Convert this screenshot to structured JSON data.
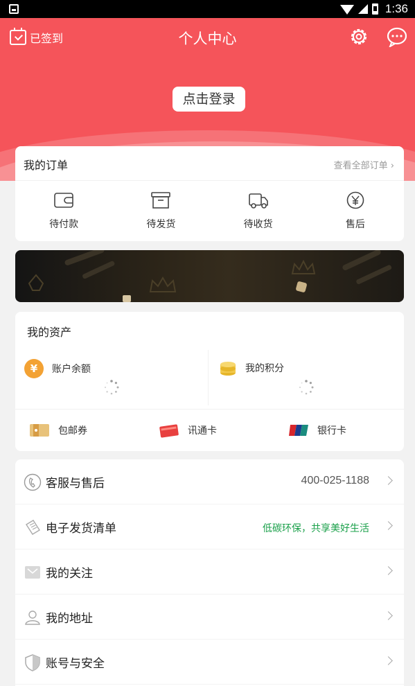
{
  "status_bar": {
    "time": "1:36"
  },
  "header": {
    "signed_label": "已签到",
    "title": "个人中心",
    "login_label": "点击登录",
    "bg_color": "#f5545a"
  },
  "orders": {
    "title": "我的订单",
    "view_all": "查看全部订单 ›",
    "items": [
      {
        "label": "待付款",
        "icon": "wallet-icon"
      },
      {
        "label": "待发货",
        "icon": "box-icon"
      },
      {
        "label": "待收货",
        "icon": "truck-icon"
      },
      {
        "label": "售后",
        "icon": "yen-circle-icon"
      }
    ]
  },
  "assets": {
    "title": "我的资产",
    "balance_label": "账户余额",
    "points_label": "我的积分",
    "coupons": [
      {
        "label": "包邮券",
        "icon": "ticket-icon"
      },
      {
        "label": "讯通卡",
        "icon": "card-icon"
      },
      {
        "label": "银行卡",
        "icon": "unionpay-icon"
      }
    ]
  },
  "menu": {
    "items": [
      {
        "label": "客服与售后",
        "value": "400-025-1188",
        "icon": "phone-icon"
      },
      {
        "label": "电子发货清单",
        "value": "低碳环保，共享美好生活",
        "icon": "receipt-icon",
        "value_color": "#1aa04a"
      },
      {
        "label": "我的关注",
        "value": "",
        "icon": "follow-icon"
      },
      {
        "label": "我的地址",
        "value": "",
        "icon": "address-icon"
      },
      {
        "label": "账号与安全",
        "value": "",
        "icon": "shield-icon"
      }
    ]
  }
}
